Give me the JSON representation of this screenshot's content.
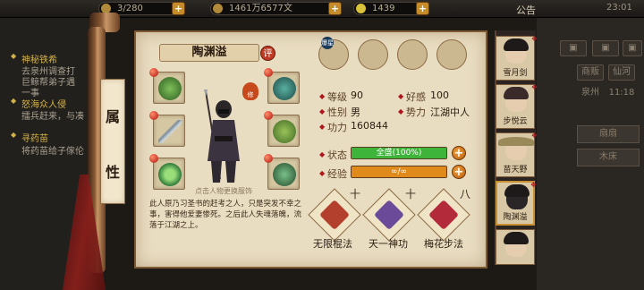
{
  "topbar": {
    "stamina": "3/280",
    "coins": "1461万6577文",
    "gold": "1439",
    "notice": "公告",
    "time": "23:01"
  },
  "quests": [
    {
      "title": "神秘铁希",
      "lines": [
        "去泉州调查打",
        "巨鲸帮弟子遇"
      ]
    },
    {
      "title": "怒海众人侵",
      "lines": [
        "一事"
      ]
    },
    {
      "title": "寻药苗",
      "lines": [
        "擂兵赶来，与凑"
      ]
    }
  ],
  "quest_extra": [
    "将药苗给子傢伦"
  ],
  "left_scroll_title": [
    "属",
    "性"
  ],
  "hero": {
    "name": "陶渊溢",
    "eval_badge": "评",
    "hint": "点击人物更换服饰",
    "xiu_badge": "修"
  },
  "top_icons": [
    {
      "name": "爆星",
      "badge": "爆星"
    },
    {
      "name": "item-2"
    },
    {
      "name": "item-3"
    },
    {
      "name": "item-4"
    }
  ],
  "stats": {
    "level_label": "等级",
    "level": "90",
    "favor_label": "好感",
    "favor": "100",
    "gender_label": "性别",
    "gender": "男",
    "force_label": "势力",
    "force": "江湖中人",
    "power_label": "功力",
    "power": "160844"
  },
  "status": {
    "label": "状态",
    "value": "全盛(100%)",
    "fill": 1.0
  },
  "exp": {
    "label": "经验",
    "value": "∞/∞",
    "fill": 1.0
  },
  "description": "此人原乃习圣书的赶考之人，只是突发不幸之事，害得他爱妻惨死。之后此人失魂落魄，流落于江湖之上。",
  "skills": [
    {
      "level": "十",
      "name": "无限棍法"
    },
    {
      "level": "十",
      "name": "天一神功"
    },
    {
      "level": "八",
      "name": "梅花步法"
    }
  ],
  "roster": [
    {
      "name": "雪月剑"
    },
    {
      "name": "步悦云"
    },
    {
      "name": "苗天野"
    },
    {
      "name": "陶渊溢"
    },
    {
      "name": ""
    }
  ],
  "right_panel": {
    "buttons": [
      "商贩",
      "仙河"
    ],
    "city": "泉州",
    "time": "11:18",
    "strips": [
      "扇扇",
      "木床"
    ]
  },
  "colors": {
    "status_fill": "#3fb43a",
    "exp_fill": "#e08a1c",
    "paper": "#e9ddc1"
  }
}
